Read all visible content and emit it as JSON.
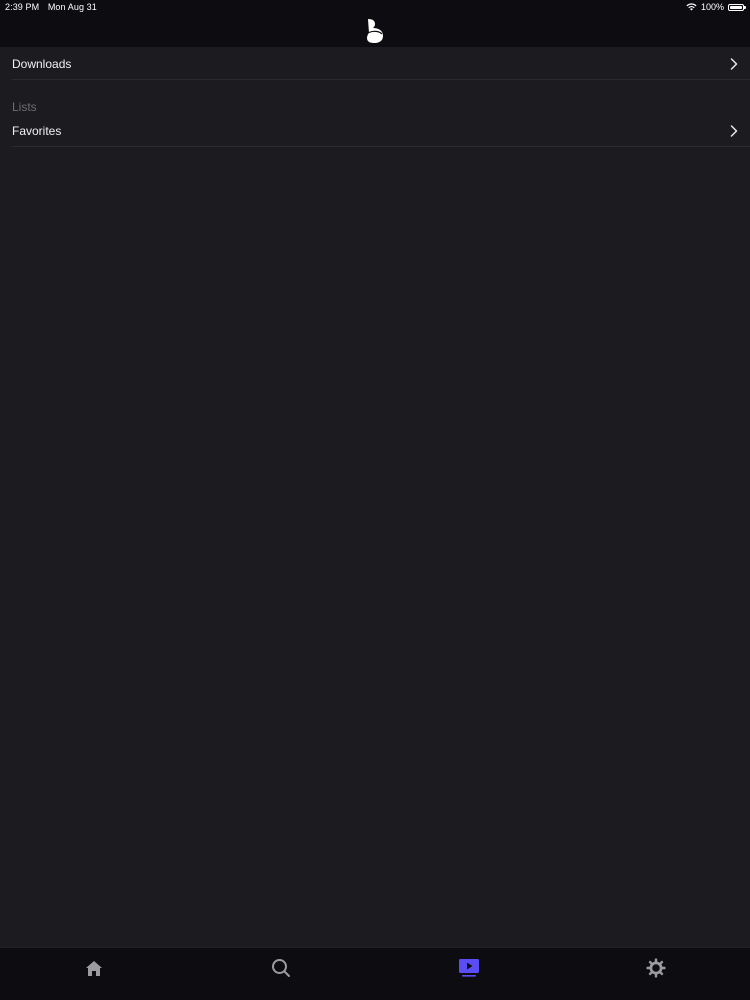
{
  "status_bar": {
    "time": "2:39 PM",
    "date": "Mon Aug 31",
    "battery": "100%"
  },
  "header": {
    "logo_icon": "brand-b-logo-icon"
  },
  "list": {
    "downloads_label": "Downloads",
    "lists_section_header": "Lists",
    "favorites_label": "Favorites"
  },
  "tabbar": {
    "items": [
      {
        "icon": "home-icon",
        "active": false
      },
      {
        "icon": "search-icon",
        "active": false
      },
      {
        "icon": "library-icon",
        "active": true
      },
      {
        "icon": "gear-icon",
        "active": false
      }
    ]
  },
  "colors": {
    "background": "#1c1b1f",
    "bars": "#0d0c10",
    "accent": "#5b4df5",
    "inactive_icon": "#9c9ba0",
    "section_header": "#6e6d72"
  }
}
